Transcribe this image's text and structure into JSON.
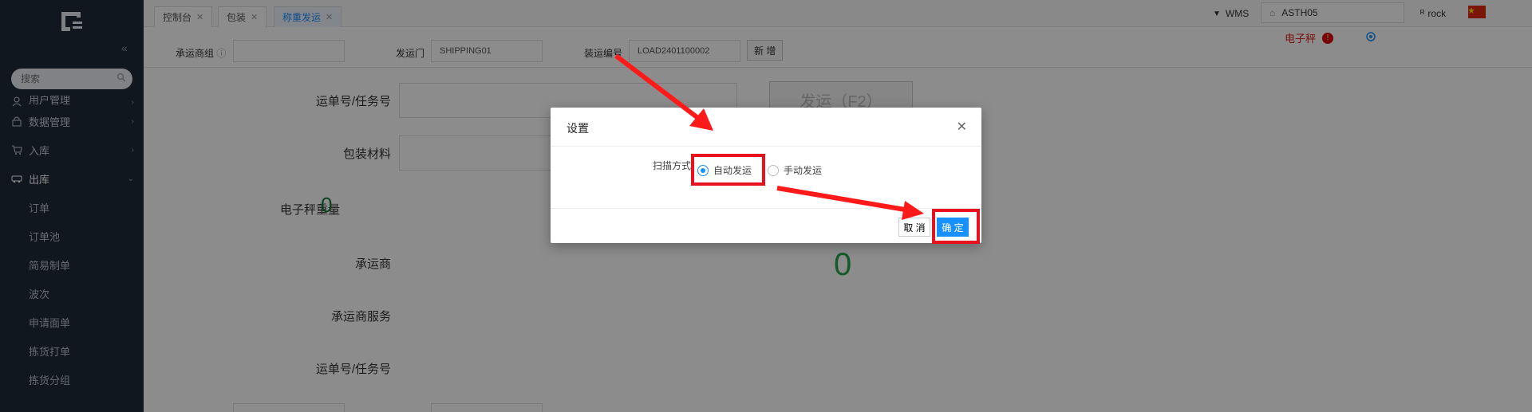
{
  "sidebar": {
    "search_placeholder": "搜索",
    "items": [
      {
        "label": "用户管理",
        "icon": "user-icon",
        "has_arrow": true
      },
      {
        "label": "数据管理",
        "icon": "lock-icon",
        "has_arrow": true
      },
      {
        "label": "入库",
        "icon": "cart-icon",
        "has_arrow": true
      },
      {
        "label": "出库",
        "icon": "truck-icon",
        "open": true
      }
    ],
    "sub_items": [
      "订单",
      "订单池",
      "简易制单",
      "波次",
      "申请面单",
      "拣货打单",
      "拣货分组"
    ]
  },
  "tabs": [
    {
      "label": "控制台"
    },
    {
      "label": "包装"
    },
    {
      "label": "称重发运",
      "active": true
    }
  ],
  "header": {
    "system": "WMS",
    "warehouse": "ASTH05",
    "user": "rock",
    "scale_label": "电子秤",
    "alert": "!"
  },
  "filters": {
    "carrier_group_label": "承运商组",
    "carrier_group_value": "",
    "dock_label": "发运门",
    "dock_value": "SHIPPING01",
    "load_label": "装运编号",
    "load_value": "LOAD2401100002",
    "new_button": "新 增"
  },
  "form": {
    "tracking_label": "运单号/任务号",
    "ship_button": "发运（F2）",
    "packing_label": "包装材料",
    "weight_label": "电子秤重量",
    "weight_value": "0",
    "carrier_label": "承运商",
    "carrier_service_label": "承运商服务",
    "tracking2_label": "运单号/任务号",
    "big_value": "0"
  },
  "modal": {
    "title": "设置",
    "scan_mode_label": "扫描方式",
    "options": [
      {
        "label": "自动发运",
        "checked": true
      },
      {
        "label": "手动发运",
        "checked": false
      }
    ],
    "cancel": "取 消",
    "confirm": "确 定"
  },
  "colors": {
    "sidebar_bg": "#1e2a3a",
    "accent": "#1890ff",
    "highlight": "#e8121e",
    "value_green": "#1a7a3a"
  }
}
